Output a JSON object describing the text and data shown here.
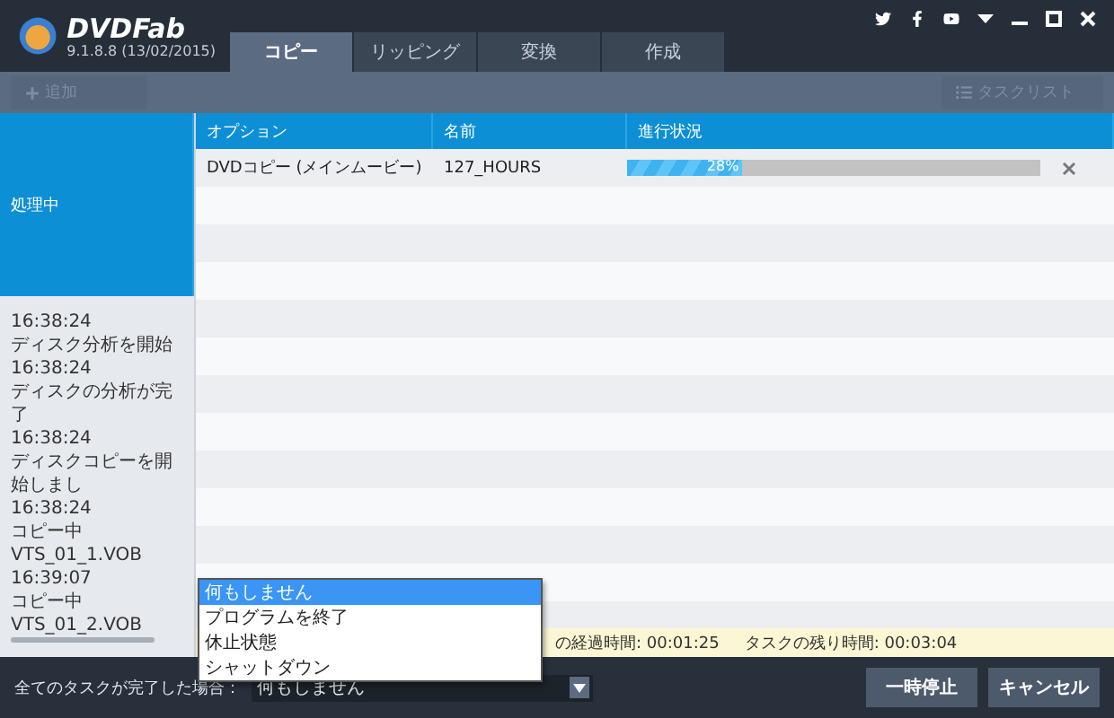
{
  "app": {
    "brand": "DVDFab",
    "version": "9.1.8.8 (13/02/2015)"
  },
  "tabs": [
    {
      "label": "コピー",
      "selected": true
    },
    {
      "label": "リッピング",
      "selected": false
    },
    {
      "label": "変換",
      "selected": false
    },
    {
      "label": "作成",
      "selected": false
    }
  ],
  "toolbar": {
    "add_button": {
      "label": "追加",
      "disabled": true
    },
    "task_list_button": {
      "label": "タスクリスト",
      "disabled": true
    }
  },
  "log_panel": {
    "header": "処理中",
    "entries": [
      "16:38:24",
      "ディスク分析を開始",
      "16:38:24",
      "ディスクの分析が完了",
      "16:38:24",
      "ディスクコピーを開始しまし",
      "16:38:24",
      "コピー中 VTS_01_1.VOB",
      "16:39:07",
      "コピー中 VTS_01_2.VOB"
    ]
  },
  "table": {
    "columns": [
      "オプション",
      "名前",
      "進行状況"
    ],
    "rows": [
      {
        "option": "DVDコピー (メインムービー)",
        "name": "127_HOURS",
        "level": 0.28,
        "reading": "28%"
      }
    ]
  },
  "status_bar": {
    "texts": [
      "の経過時間: 00:01:25",
      "タスクの残り時間: 00:03:04"
    ]
  },
  "footer": {
    "label": "全てのタスクが完了した場合：",
    "select_value": "何もしません",
    "expanded": true,
    "options": [
      {
        "label": "何もしません",
        "selected": true
      },
      {
        "label": "プログラムを終了",
        "selected": false
      },
      {
        "label": "休止状態",
        "selected": false
      },
      {
        "label": "シャットダウン",
        "selected": false
      }
    ],
    "buttons": [
      "一時停止",
      "キャンセル"
    ]
  }
}
